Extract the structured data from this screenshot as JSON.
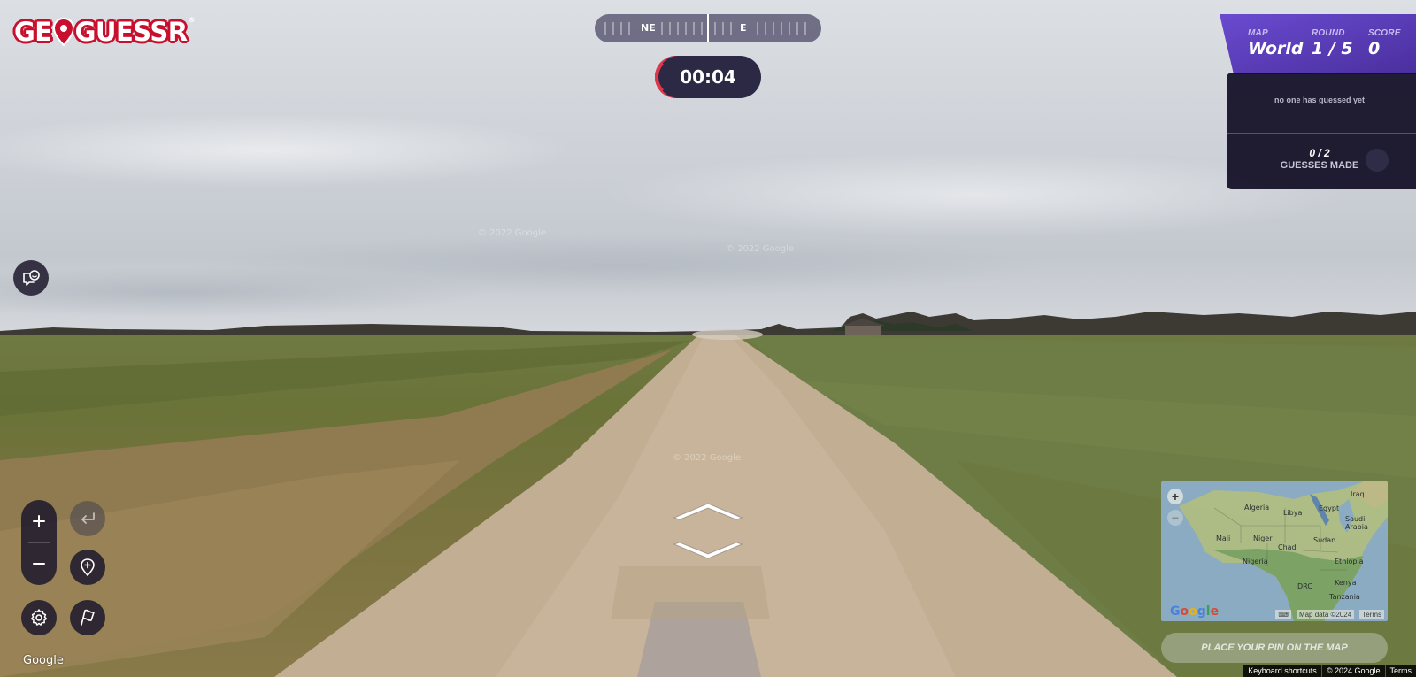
{
  "logo": {
    "text_left": "GE",
    "text_right": "GUESSR",
    "mark": "®"
  },
  "compass": {
    "label_ne": "NE",
    "label_e": "E"
  },
  "timer": {
    "value": "00:04",
    "remaining_fraction": 0.04
  },
  "status": {
    "map_label": "MAP",
    "map_value": "World",
    "round_label": "ROUND",
    "round_value": "1 / 5",
    "score_label": "SCORE",
    "score_value": "0",
    "message": "no one has guessed yet",
    "guesses_count": "0 / 2",
    "guesses_label": "GUESSES MADE"
  },
  "scene": {
    "watermarks": [
      "© 2022 Google",
      "© 2022 Google",
      "© 2022 Google"
    ]
  },
  "controls": {
    "chat_icon": "chat-icon",
    "zoom_in_icon": "plus-icon",
    "zoom_out_icon": "minus-icon",
    "undo_icon": "undo-icon",
    "checkpoint_icon": "pin-plus-icon",
    "settings_icon": "gear-icon",
    "flag_icon": "flag-icon"
  },
  "minimap": {
    "labels": [
      "Algeria",
      "Libya",
      "Egypt",
      "Iraq",
      "Saudi Arabia",
      "Mali",
      "Niger",
      "Chad",
      "Sudan",
      "Nigeria",
      "Ethiopia",
      "Kenya",
      "DRC",
      "Tanzania"
    ],
    "attribution": "Map data ©2024",
    "terms": "Terms",
    "zoom_in": "+",
    "zoom_out": "−",
    "google": "Google"
  },
  "guess_button": {
    "label": "PLACE YOUR PIN ON THE MAP"
  },
  "footer": {
    "google": "Google",
    "keyboard_shortcuts": "Keyboard shortcuts",
    "copyright": "© 2024 Google",
    "terms": "Terms"
  },
  "colors": {
    "brand_red": "#c8102e",
    "panel_purple": "#5b3fb0",
    "timer_red": "#e0364c"
  }
}
